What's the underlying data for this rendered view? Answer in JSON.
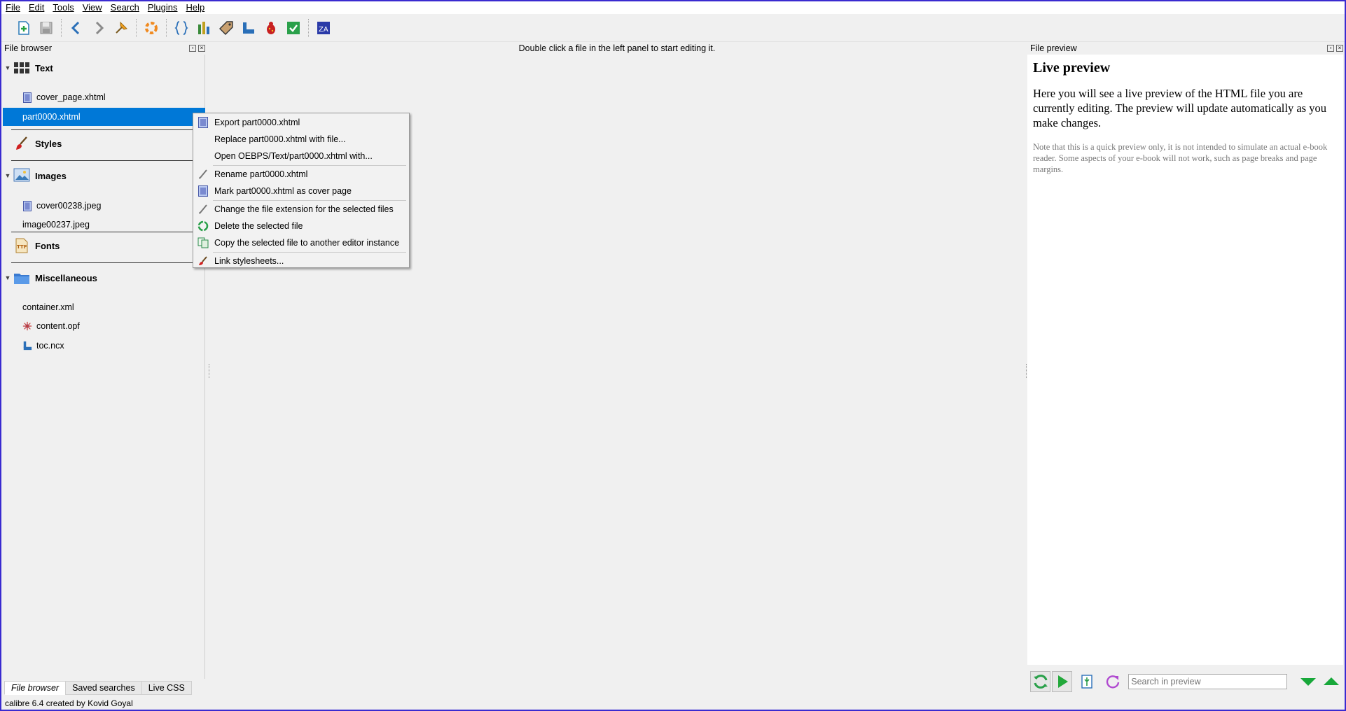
{
  "menubar": {
    "items": [
      {
        "label": "File"
      },
      {
        "label": "Edit"
      },
      {
        "label": "Tools"
      },
      {
        "label": "View"
      },
      {
        "label": "Search"
      },
      {
        "label": "Plugins"
      },
      {
        "label": "Help"
      }
    ]
  },
  "toolbar": {
    "icons": [
      "new-file-icon",
      "save-icon",
      "back-icon",
      "forward-icon",
      "checkpoint-icon",
      "fix-html-icon",
      "beautify-icon",
      "reports-icon",
      "tag-icon",
      "toc-icon",
      "check-book-icon",
      "checkmark-icon",
      "spell-check-icon"
    ]
  },
  "left_dock": {
    "title": "File browser",
    "categories": {
      "text": "Text",
      "styles": "Styles",
      "images": "Images",
      "fonts": "Fonts",
      "misc": "Miscellaneous"
    },
    "files": {
      "cover_page": "cover_page.xhtml",
      "part0000": "part0000.xhtml",
      "cover_img": "cover00238.jpeg",
      "image237": "image00237.jpeg",
      "container": "container.xml",
      "content_opf": "content.opf",
      "toc": "toc.ncx"
    },
    "bottom_tabs": [
      "File browser",
      "Saved searches",
      "Live CSS"
    ]
  },
  "center": {
    "message": "Double click a file in the left panel to start editing it."
  },
  "context_menu": {
    "items": [
      {
        "label": "Export part0000.xhtml",
        "icon": "export-icon"
      },
      {
        "label": "Replace part0000.xhtml with file...",
        "icon": ""
      },
      {
        "label": "Open OEBPS/Text/part0000.xhtml with...",
        "icon": ""
      },
      {
        "label": "Rename part0000.xhtml",
        "icon": "rename-icon"
      },
      {
        "label": "Mark part0000.xhtml as cover page",
        "icon": "cover-icon"
      },
      {
        "label": "Change the file extension for the selected files",
        "icon": "rename-icon"
      },
      {
        "label": "Delete the selected file",
        "icon": "recycle-icon"
      },
      {
        "label": "Copy the selected file to another editor instance",
        "icon": "copy-icon"
      },
      {
        "label": "Link stylesheets...",
        "icon": "brush-icon"
      }
    ]
  },
  "right_dock": {
    "title": "File preview",
    "preview_heading": "Live preview",
    "preview_lead": "Here you will see a live preview of the HTML file you are currently editing. The preview will update automatically as you make changes.",
    "preview_note": "Note that this is a quick preview only, it is not intended to simulate an actual e-book reader. Some aspects of your e-book will not work, such as page breaks and page margins.",
    "search_placeholder": "Search in preview"
  },
  "status": {
    "text": "calibre 6.4 created by Kovid Goyal"
  },
  "colors": {
    "selection": "#0078d7",
    "frame": "#3a2bd0"
  }
}
